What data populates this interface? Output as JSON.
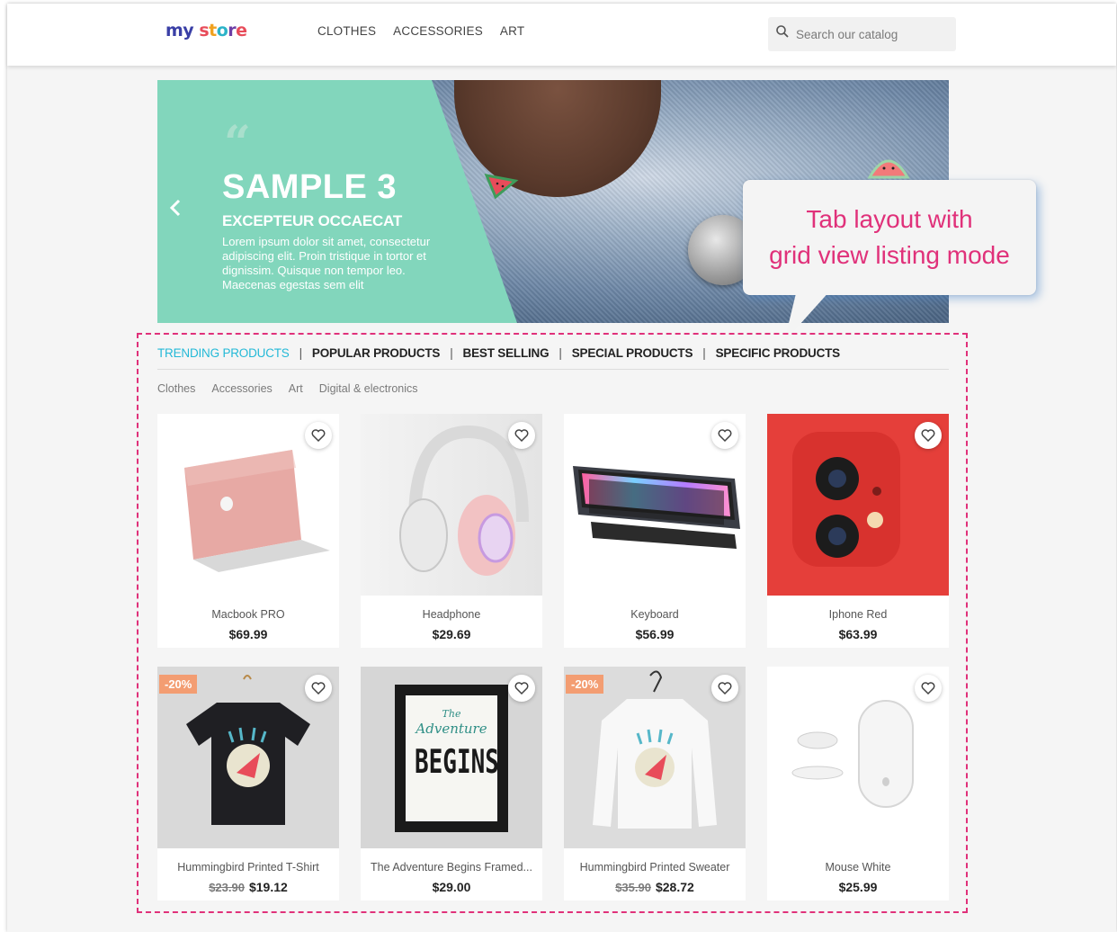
{
  "header": {
    "logo": {
      "part1": "my",
      "part2": [
        "s",
        "t",
        "o",
        "r",
        "e"
      ]
    },
    "nav": [
      "CLOTHES",
      "ACCESSORIES",
      "ART"
    ],
    "search_placeholder": "Search our catalog"
  },
  "slider": {
    "title": "SAMPLE 3",
    "subtitle": "EXCEPTEUR OCCAECAT",
    "text": "Lorem ipsum dolor sit amet, consectetur adipiscing elit. Proin tristique in tortor et dignissim. Quisque non tempor leo. Maecenas egestas sem elit",
    "accent": "#82d6bc"
  },
  "callout": {
    "line1": "Tab layout with",
    "line2": "grid view listing mode",
    "color": "#e0317a"
  },
  "tabs": [
    "TRENDING PRODUCTS",
    "POPULAR PRODUCTS",
    "BEST SELLING",
    "SPECIAL PRODUCTS",
    "SPECIFIC PRODUCTS"
  ],
  "active_tab": "TRENDING PRODUCTS",
  "categories": [
    "Clothes",
    "Accessories",
    "Art",
    "Digital & electronics"
  ],
  "products": [
    {
      "name": "Macbook PRO",
      "price": "$69.99",
      "image": "laptop-image"
    },
    {
      "name": "Headphone",
      "price": "$29.69",
      "image": "headphone-image"
    },
    {
      "name": "Keyboard",
      "price": "$56.99",
      "image": "keyboard-image"
    },
    {
      "name": "Iphone Red",
      "price": "$63.99",
      "image": "phone-image"
    },
    {
      "name": "Hummingbird Printed T-Shirt",
      "old_price": "$23.90",
      "price": "$19.12",
      "badge": "-20%",
      "image": "tshirt-image"
    },
    {
      "name": "The Adventure Begins Framed...",
      "price": "$29.00",
      "image": "poster-image"
    },
    {
      "name": "Hummingbird Printed Sweater",
      "old_price": "$35.90",
      "price": "$28.72",
      "badge": "-20%",
      "image": "sweater-image"
    },
    {
      "name": "Mouse White",
      "price": "$25.99",
      "image": "mouse-image"
    }
  ],
  "poster_text": {
    "the": "The",
    "adventure": "Adventure",
    "begins": "BEGINS"
  }
}
